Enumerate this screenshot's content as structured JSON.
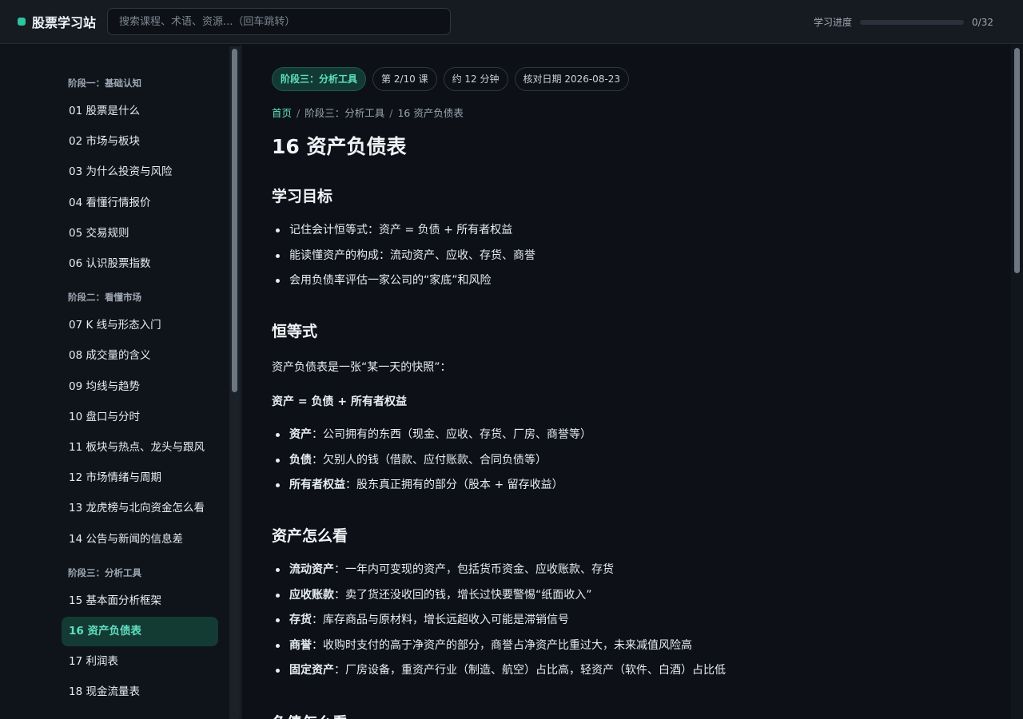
{
  "app": {
    "title": "股票学习站",
    "accent": "#2ec4a0"
  },
  "search": {
    "placeholder": "搜索课程、术语、资源...（回车跳转）"
  },
  "progress": {
    "label": "学习进度",
    "count": "0/32",
    "fraction": 0
  },
  "sidebar": {
    "stages": [
      {
        "title": "阶段一：基础认知",
        "items": [
          "01 股票是什么",
          "02 市场与板块",
          "03 为什么投资与风险",
          "04 看懂行情报价",
          "05 交易规则",
          "06 认识股票指数"
        ]
      },
      {
        "title": "阶段二：看懂市场",
        "items": [
          "07 K 线与形态入门",
          "08 成交量的含义",
          "09 均线与趋势",
          "10 盘口与分时",
          "11 板块与热点、龙头与跟风",
          "12 市场情绪与周期",
          "13 龙虎榜与北向资金怎么看",
          "14 公告与新闻的信息差"
        ]
      },
      {
        "title": "阶段三：分析工具",
        "items": [
          "15 基本面分析框架",
          "16 资产负债表",
          "17 利润表",
          "18 现金流量表"
        ]
      }
    ],
    "active": "16 资产负债表"
  },
  "lesson": {
    "chips": [
      "阶段三：分析工具",
      "第 2/10 课",
      "约 12 分钟",
      "核对日期 2026-08-23"
    ],
    "breadcrumb": {
      "home": "首页",
      "stage": "阶段三：分析工具",
      "current": "16 资产负债表"
    },
    "title": "16 资产负债表",
    "goals": {
      "heading": "学习目标",
      "items": [
        "记住会计恒等式：资产 = 负债 + 所有者权益",
        "能读懂资产的构成：流动资产、应收、存货、商誉",
        "会用负债率评估一家公司的“家底”和风险"
      ]
    },
    "identity": {
      "heading": "恒等式",
      "intro": "资产负债表是一张“某一天的快照”：",
      "formula": "资产 = 负债 + 所有者权益",
      "items": [
        {
          "term": "资产",
          "desc": "：公司拥有的东西（现金、应收、存货、厂房、商誉等）"
        },
        {
          "term": "负债",
          "desc": "：欠别人的钱（借款、应付账款、合同负债等）"
        },
        {
          "term": "所有者权益",
          "desc": "：股东真正拥有的部分（股本 + 留存收益）"
        }
      ]
    },
    "assets": {
      "heading": "资产怎么看",
      "items": [
        {
          "term": "流动资产",
          "desc": "：一年内可变现的资产，包括货币资金、应收账款、存货"
        },
        {
          "term": "应收账款",
          "desc": "：卖了货还没收回的钱，增长过快要警惕“纸面收入”"
        },
        {
          "term": "存货",
          "desc": "：库存商品与原材料，增长远超收入可能是滞销信号"
        },
        {
          "term": "商誉",
          "desc": "：收购时支付的高于净资产的部分，商誉占净资产比重过大，未来减值风险高"
        },
        {
          "term": "固定资产",
          "desc": "：厂房设备，重资产行业（制造、航空）占比高，轻资产（软件、白酒）占比低"
        }
      ]
    },
    "liabilities": {
      "heading": "负债怎么看"
    }
  }
}
